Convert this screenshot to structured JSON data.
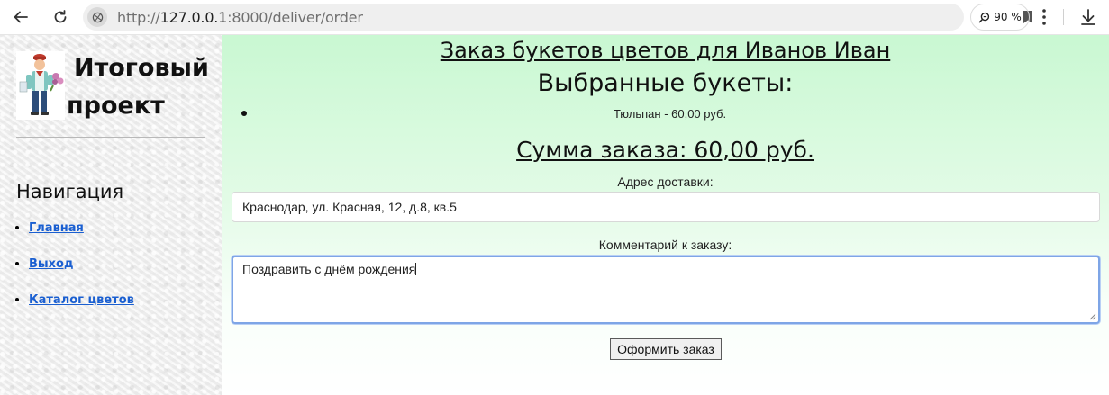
{
  "browser": {
    "url_prefix": "http://",
    "url_host": "127.0.0.1",
    "url_rest": ":8000/deliver/order",
    "zoom": "90 %"
  },
  "sidebar": {
    "title_line1": "Итоговый",
    "title_line2": "проект",
    "nav_heading": "Навигация",
    "items": [
      {
        "label": "Главная"
      },
      {
        "label": "Выход"
      },
      {
        "label": "Каталог цветов"
      }
    ]
  },
  "main": {
    "order_title": "Заказ букетов цветов для Иванов Иван",
    "selected_heading": "Выбранные букеты:",
    "bouquets": [
      {
        "text": "Тюльпан - 60,00 руб."
      }
    ],
    "total": "Сумма заказа: 60,00 руб.",
    "address_label": "Адрес доставки:",
    "address_value": "Краснодар, ул. Красная, 12, д.8, кв.5",
    "comment_label": "Комментарий к заказу:",
    "comment_value": "Поздравить с днём рождения",
    "submit_label": "Оформить заказ"
  },
  "colors": {
    "main_bg_top": "#c9f8d2",
    "link": "#1a5fd1",
    "focus_border": "#7ea5e6"
  },
  "icons": [
    "back-arrow-icon",
    "reload-icon",
    "site-info-icon",
    "bookmark-icon",
    "zoom-icon",
    "menu-dots-icon",
    "download-icon"
  ]
}
